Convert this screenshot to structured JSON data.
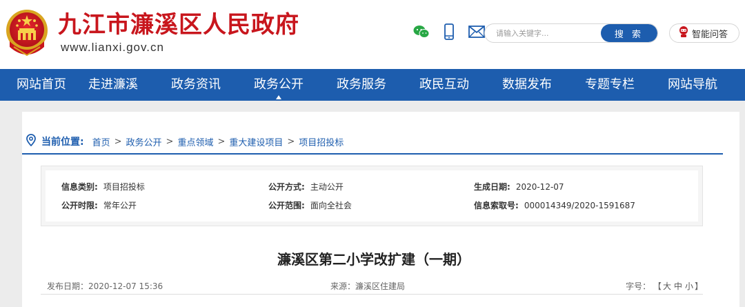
{
  "header": {
    "site_title": "九江市濂溪区人民政府",
    "site_url": "www.lianxi.gov.cn",
    "search": {
      "placeholder": "请输入关键字...",
      "button_label": "搜 索"
    },
    "qa_label": "智能问答",
    "icons": [
      "wechat-icon",
      "mobile-icon",
      "mail-icon",
      "robot-icon"
    ],
    "colors": {
      "title_red": "#c8161d",
      "brand_blue": "#1d5dae"
    }
  },
  "nav": {
    "items": [
      {
        "label": "网站首页"
      },
      {
        "label": "走进濂溪"
      },
      {
        "label": "政务资讯"
      },
      {
        "label": "政务公开",
        "active": true
      },
      {
        "label": "政务服务"
      },
      {
        "label": "政民互动"
      },
      {
        "label": "数据发布"
      },
      {
        "label": "专题专栏"
      },
      {
        "label": "网站导航"
      }
    ]
  },
  "breadcrumb": {
    "label": "当前位置:",
    "items": [
      "首页",
      "政务公开",
      "重点领域",
      "重大建设项目",
      "项目招投标"
    ],
    "separator": ">"
  },
  "info": {
    "category_key": "信息类别:",
    "category_val": "项目招投标",
    "method_key": "公开方式:",
    "method_val": "主动公开",
    "created_key": "生成日期:",
    "created_val": "2020-12-07",
    "period_key": "公开时限:",
    "period_val": "常年公开",
    "scope_key": "公开范围:",
    "scope_val": "面向全社会",
    "index_key": "信息索取号:",
    "index_val": "000014349/2020-1591687"
  },
  "article": {
    "title": "濂溪区第二小学改扩建（一期）",
    "publish_date": "发布日期：2020-12-07 15:36",
    "source": "来源：濂溪区住建局",
    "font_size_label": "字号：",
    "font_sizes": [
      "大",
      "中",
      "小"
    ],
    "bracket_open": "【",
    "bracket_close": "】"
  }
}
